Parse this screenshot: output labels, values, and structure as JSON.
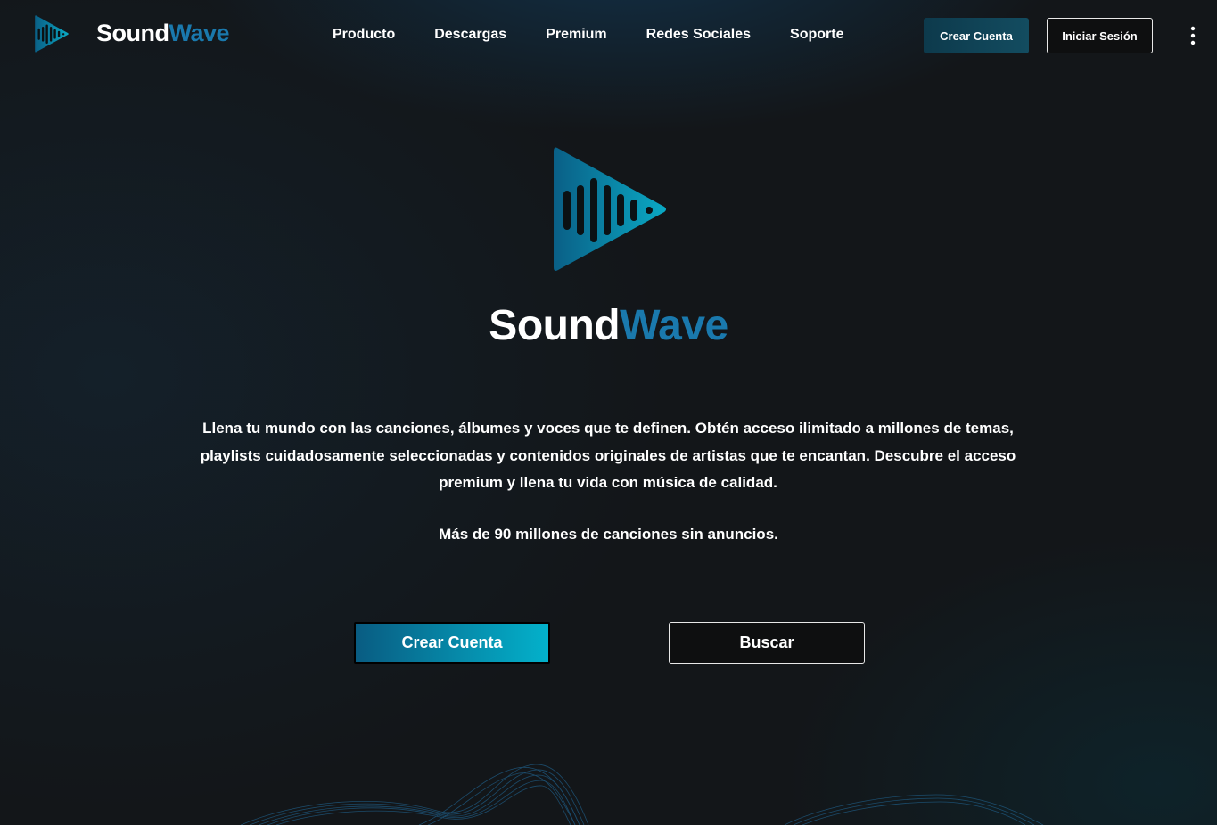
{
  "brand": {
    "part1": "Sound",
    "part2": "Wave"
  },
  "nav": {
    "links": [
      "Producto",
      "Descargas",
      "Premium",
      "Redes Sociales",
      "Soporte"
    ],
    "signup_label": "Crear Cuenta",
    "login_label": "Iniciar Sesión"
  },
  "hero": {
    "description": "Llena tu mundo con las canciones, álbumes y voces que te definen. Obtén acceso ilimitado a millones de temas, playlists cuidadosamente seleccionadas y contenidos originales de artistas que te encantan. Descubre el acceso premium y llena tu vida con música de calidad.",
    "tagline": "Más de 90 millones de canciones sin anuncios.",
    "signup_label": "Crear Cuenta",
    "search_label": "Buscar"
  },
  "icons": {
    "logo": "play-soundwave-icon",
    "more": "more-vertical-icon"
  },
  "colors": {
    "background": "#131619",
    "accent": "#1a79ad",
    "button_gradient_start": "#095c82",
    "button_gradient_end": "#03b1cb",
    "text": "#ffffff"
  }
}
